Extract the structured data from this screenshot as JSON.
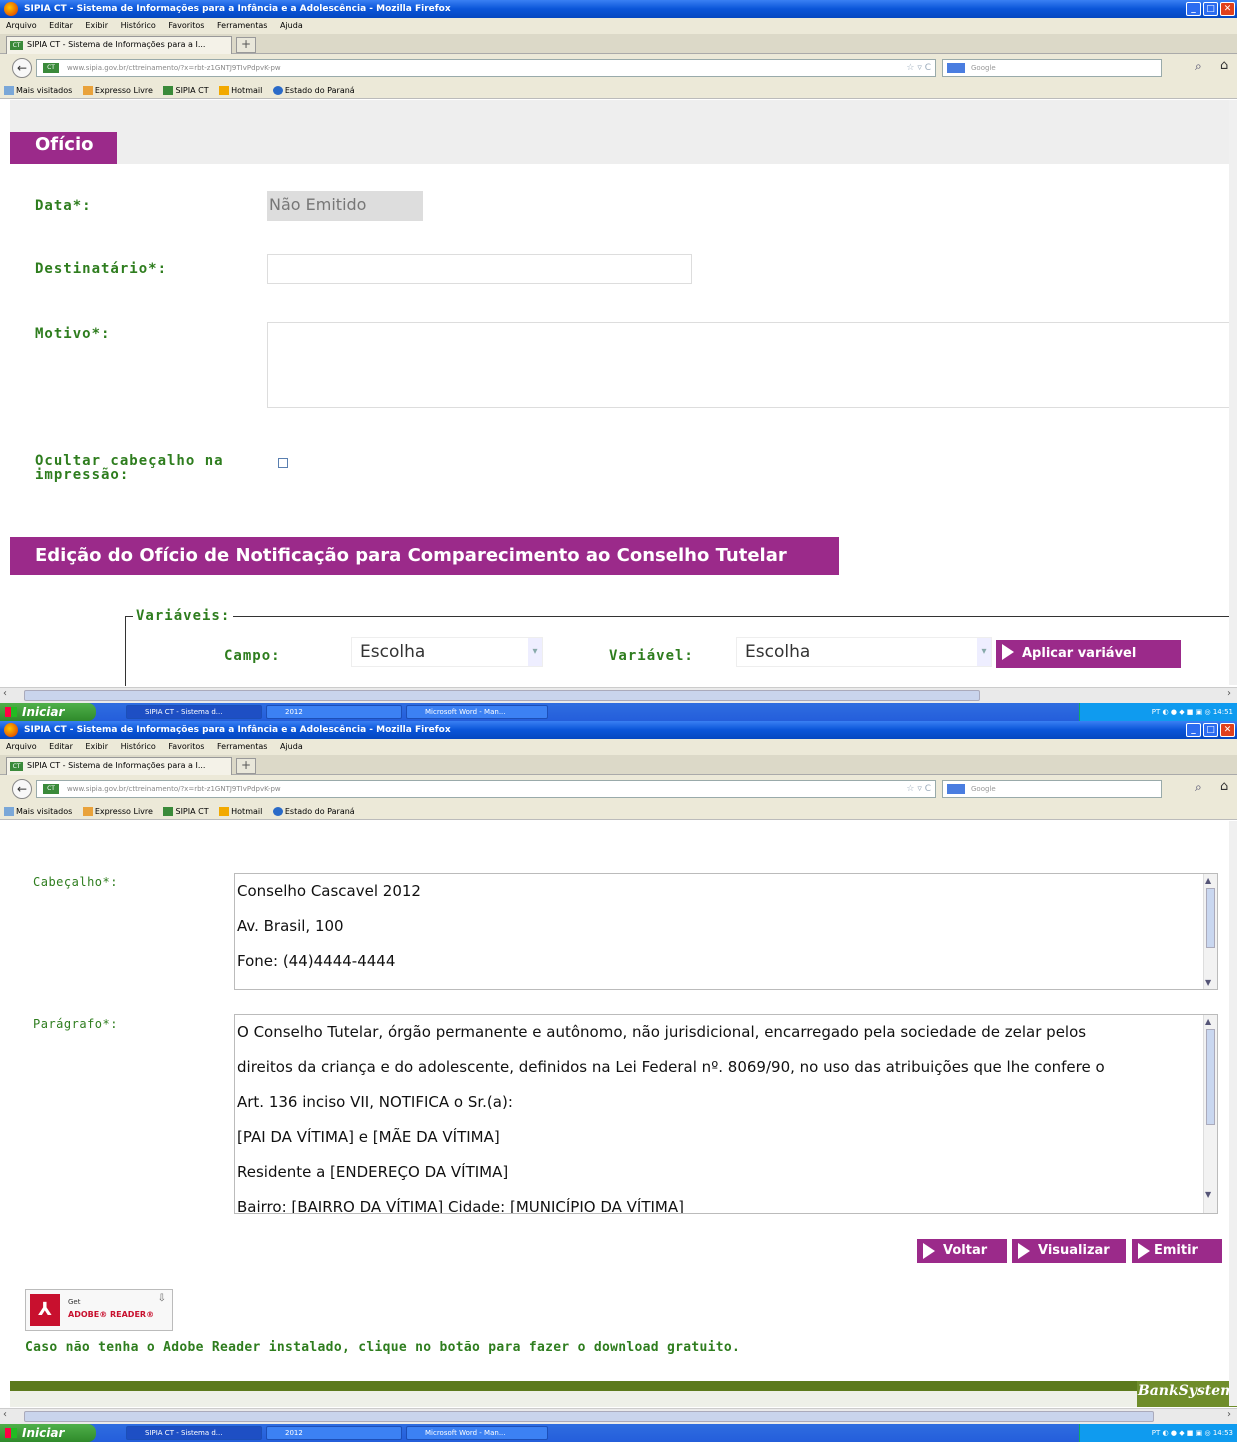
{
  "browser": {
    "window_title": "SIPIA CT - Sistema de Informações para a Infância e a Adolescência - Mozilla Firefox",
    "menu": [
      "Arquivo",
      "Editar",
      "Exibir",
      "Histórico",
      "Favoritos",
      "Ferramentas",
      "Ajuda"
    ],
    "tab_label": "SIPIA CT - Sistema de Informações para a I...",
    "url": "www.sipia.gov.br/cttreinamento/?x=rbt-z1GNTJ9TIvPdpvK-pw",
    "search_placeholder": "Google",
    "bookmarks": [
      "Mais visitados",
      "Expresso Livre",
      "SIPIA CT",
      "Hotmail",
      "Estado do Paraná"
    ]
  },
  "taskbar": {
    "start": "Iniciar",
    "tasks": [
      "SIPIA CT - Sistema d...",
      "2012",
      "Microsoft Word - Man..."
    ],
    "tray_lang": "PT",
    "clock_1": "14:51",
    "clock_2": "14:53"
  },
  "screen1": {
    "section_title": "Ofício",
    "data_label": "Data*:",
    "data_value": "Não Emitido",
    "destinatario_label": "Destinatário*:",
    "destinatario_value": "",
    "motivo_label": "Motivo*:",
    "ocultar_label_1": "Ocultar cabeçalho na",
    "ocultar_label_2": "impressão:",
    "edit_title": "Edição do Ofício de Notificação para Comparecimento ao Conselho Tutelar",
    "variaveis_legend": "Variáveis:",
    "campo_label": "Campo:",
    "campo_value": "Escolha",
    "variavel_label": "Variável:",
    "variavel_value": "Escolha",
    "aplicar_button": "Aplicar variável"
  },
  "screen2": {
    "cabecalho_label": "Cabeçalho*:",
    "cabecalho_lines": [
      "Conselho Cascavel 2012",
      "Av. Brasil, 100",
      "Fone: (44)4444-4444"
    ],
    "paragrafo_label": "Parágrafo*:",
    "paragrafo_lines": [
      "O Conselho Tutelar, órgão permanente e autônomo, não jurisdicional, encarregado pela sociedade de zelar pelos",
      "direitos da criança e do adolescente, definidos na Lei Federal nº. 8069/90, no uso das atribuições que lhe confere o",
      "Art. 136 inciso VII, NOTIFICA o Sr.(a):",
      "[PAI DA VÍTIMA] e [MÃE DA VÍTIMA]",
      "Residente a [ENDEREÇO DA VÍTIMA]",
      "Bairro: [BAIRRO DA VÍTIMA] Cidade: [MUNICÍPIO DA VÍTIMA]"
    ],
    "voltar_button": "Voltar",
    "visualizar_button": "Visualizar",
    "emitir_button": "Emitir",
    "adobe_get": "Get",
    "adobe_reader": "ADOBE® READER®",
    "adobe_note": "Caso não tenha o Adobe Reader instalado, clique no botão para fazer o download gratuito.",
    "footer_brand": "BankSystem"
  },
  "colors": {
    "purple": "#9b2a8a",
    "green_label": "#2e7d1e",
    "footer_green": "#5c7a1c",
    "xp_blue": "#245edb"
  }
}
